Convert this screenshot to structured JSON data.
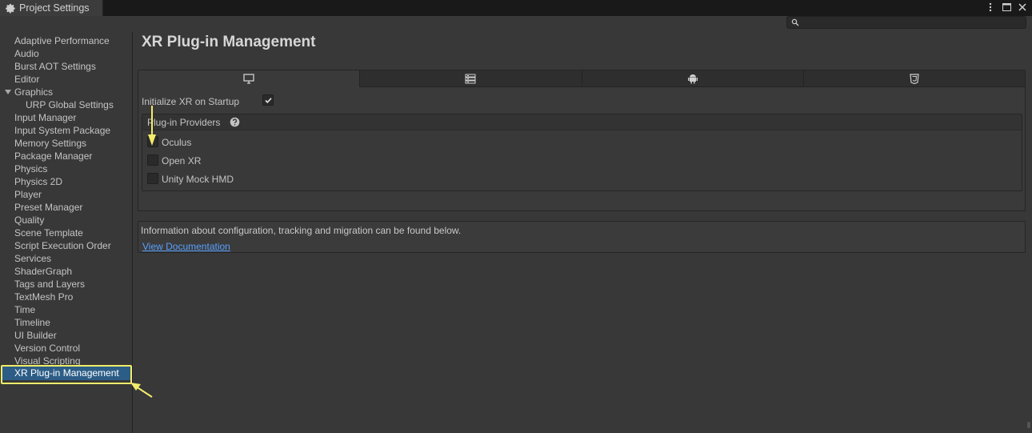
{
  "window": {
    "tab_title": "Project Settings",
    "controls": [
      "more-icon",
      "maximize-icon",
      "close-icon"
    ]
  },
  "search": {
    "placeholder": "",
    "value": ""
  },
  "sidebar": {
    "items": [
      {
        "label": "Adaptive Performance"
      },
      {
        "label": "Audio"
      },
      {
        "label": "Burst AOT Settings"
      },
      {
        "label": "Editor"
      },
      {
        "label": "Graphics",
        "expanded": true
      },
      {
        "label": "URP Global Settings",
        "child": true
      },
      {
        "label": "Input Manager"
      },
      {
        "label": "Input System Package"
      },
      {
        "label": "Memory Settings"
      },
      {
        "label": "Package Manager"
      },
      {
        "label": "Physics"
      },
      {
        "label": "Physics 2D"
      },
      {
        "label": "Player"
      },
      {
        "label": "Preset Manager"
      },
      {
        "label": "Quality"
      },
      {
        "label": "Scene Template"
      },
      {
        "label": "Script Execution Order"
      },
      {
        "label": "Services"
      },
      {
        "label": "ShaderGraph"
      },
      {
        "label": "Tags and Layers"
      },
      {
        "label": "TextMesh Pro"
      },
      {
        "label": "Time"
      },
      {
        "label": "Timeline"
      },
      {
        "label": "UI Builder"
      },
      {
        "label": "Version Control"
      },
      {
        "label": "Visual Scripting"
      },
      {
        "label": "XR Plug-in Management",
        "selected": true
      }
    ]
  },
  "main": {
    "title": "XR Plug-in Management",
    "platform_tabs": [
      {
        "icon": "desktop-icon",
        "active": true
      },
      {
        "icon": "server-icon",
        "active": false
      },
      {
        "icon": "android-icon",
        "active": false
      },
      {
        "icon": "html5-icon",
        "active": false
      }
    ],
    "initialize_label": "Initialize XR on Startup",
    "initialize_checked": true,
    "providers": {
      "title": "Plug-in Providers",
      "items": [
        {
          "label": "Oculus",
          "checked": false
        },
        {
          "label": "Open XR",
          "checked": false
        },
        {
          "label": "Unity Mock HMD",
          "checked": false
        }
      ]
    },
    "info_text": "Information about configuration, tracking and migration can be found below.",
    "link_text": "View Documentation"
  },
  "colors": {
    "selection": "#2c5d87",
    "highlight_frame": "#f2ec6b",
    "link": "#59a0ff"
  }
}
